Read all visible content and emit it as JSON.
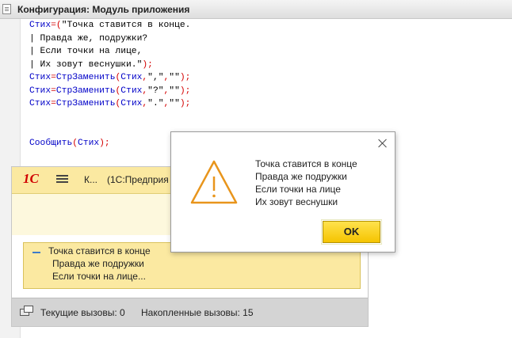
{
  "configurator": {
    "title": "Конфигурация: Модуль приложения",
    "code_lines": [
      [
        {
          "t": "Стих",
          "c": "kw"
        },
        {
          "t": "=(",
          "c": "op"
        },
        {
          "t": "\"Точка ставится в конце.",
          "c": "str"
        }
      ],
      [
        {
          "t": "| Правда же, подружки?",
          "c": "str"
        }
      ],
      [
        {
          "t": "| Если точки на лице,",
          "c": "str"
        }
      ],
      [
        {
          "t": "| Их зовут веснушки.\"",
          "c": "str"
        },
        {
          "t": ");",
          "c": "op"
        }
      ],
      [
        {
          "t": "Стих",
          "c": "kw"
        },
        {
          "t": "=",
          "c": "op"
        },
        {
          "t": "СтрЗаменить",
          "c": "kw"
        },
        {
          "t": "(",
          "c": "op"
        },
        {
          "t": "Стих",
          "c": "kw"
        },
        {
          "t": ",",
          "c": "op"
        },
        {
          "t": "\",\"",
          "c": "str"
        },
        {
          "t": ",",
          "c": "op"
        },
        {
          "t": "\"\"",
          "c": "str"
        },
        {
          "t": ");",
          "c": "op"
        }
      ],
      [
        {
          "t": "Стих",
          "c": "kw"
        },
        {
          "t": "=",
          "c": "op"
        },
        {
          "t": "СтрЗаменить",
          "c": "kw"
        },
        {
          "t": "(",
          "c": "op"
        },
        {
          "t": "Стих",
          "c": "kw"
        },
        {
          "t": ",",
          "c": "op"
        },
        {
          "t": "\"?\"",
          "c": "str"
        },
        {
          "t": ",",
          "c": "op"
        },
        {
          "t": "\"\"",
          "c": "str"
        },
        {
          "t": ");",
          "c": "op"
        }
      ],
      [
        {
          "t": "Стих",
          "c": "kw"
        },
        {
          "t": "=",
          "c": "op"
        },
        {
          "t": "СтрЗаменить",
          "c": "kw"
        },
        {
          "t": "(",
          "c": "op"
        },
        {
          "t": "Стих",
          "c": "kw"
        },
        {
          "t": ",",
          "c": "op"
        },
        {
          "t": "\".\"",
          "c": "str"
        },
        {
          "t": ",",
          "c": "op"
        },
        {
          "t": "\"\"",
          "c": "str"
        },
        {
          "t": ");",
          "c": "op"
        }
      ],
      [],
      [],
      [
        {
          "t": "Сообщить",
          "c": "kw"
        },
        {
          "t": "(",
          "c": "op"
        },
        {
          "t": "Стих",
          "c": "kw"
        },
        {
          "t": ");",
          "c": "op"
        }
      ]
    ]
  },
  "enterprise": {
    "logo": "1С",
    "title_prefix": "К...",
    "title": "(1С:Предприя",
    "messages": [
      "Точка ставится в конце",
      "Правда же подружки",
      "Если точки на лице..."
    ],
    "status": {
      "current_calls": "Текущие вызовы: 0",
      "accumulated_calls": "Накопленные вызовы: 15"
    }
  },
  "dialog": {
    "lines": [
      "Точка ставится в конце",
      " Правда же подружки",
      " Если точки на лице",
      " Их зовут веснушки"
    ],
    "ok_label": "OK",
    "icon": "warning-icon",
    "accent": "#e8951c"
  },
  "colors": {
    "keyword": "#0000c8",
    "operator": "#d40000",
    "panel_yellow": "#fbe9a1",
    "button_yellow": "#f5c400"
  }
}
